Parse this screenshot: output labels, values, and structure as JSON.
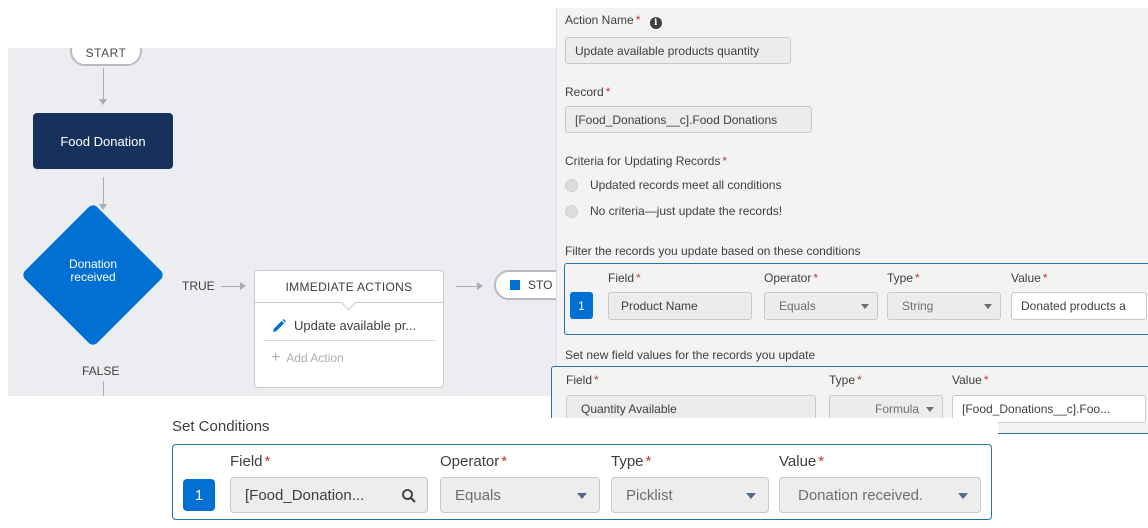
{
  "flow": {
    "start_label": "START",
    "node_food": "Food Donation",
    "decision_label": "Donation\nreceived",
    "decision_line1": "Donation",
    "decision_line2": "received",
    "true_label": "TRUE",
    "false_label": "FALSE",
    "actions_header": "IMMEDIATE ACTIONS",
    "action_item": "Update available pr...",
    "add_action": "Add Action",
    "stop_label": "STO"
  },
  "panel": {
    "action_name_label": "Action Name",
    "action_name_value": "Update available products quantity",
    "record_label": "Record",
    "record_value": "[Food_Donations__c].Food Donations",
    "criteria_label": "Criteria for Updating Records",
    "criteria_options": [
      "Updated records meet all conditions",
      "No criteria—just update the records!"
    ],
    "filter_label": "Filter the records you update based on these conditions",
    "filter_cols": {
      "field": "Field",
      "operator": "Operator",
      "type": "Type",
      "value": "Value"
    },
    "filter_row": {
      "index": "1",
      "field": "Product Name",
      "operator": "Equals",
      "type": "String",
      "value": "Donated products a"
    },
    "set_label": "Set new field values for the records you update",
    "set_cols": {
      "field": "Field",
      "type": "Type",
      "value": "Value"
    },
    "set_row": {
      "field": "Quantity Available",
      "type": "Formula",
      "value": "[Food_Donations__c].Foo..."
    }
  },
  "conditions": {
    "title": "Set Conditions",
    "cols": {
      "field": "Field",
      "operator": "Operator",
      "type": "Type",
      "value": "Value"
    },
    "row": {
      "index": "1",
      "field": "[Food_Donation...",
      "operator": "Equals",
      "type": "Picklist",
      "value": "Donation received."
    }
  },
  "colors": {
    "accent": "#0070d2",
    "dark_node": "#16325c",
    "required": "#c23934",
    "canvas": "#ebedf0"
  }
}
